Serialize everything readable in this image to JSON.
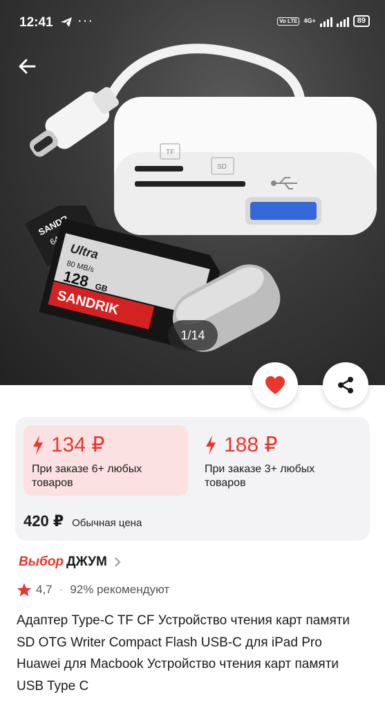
{
  "status_bar": {
    "time": "12:41",
    "more": "···",
    "volte": "Vo LTE",
    "network": "4G+",
    "battery": "89"
  },
  "gallery": {
    "counter": "1/14",
    "sd_card": {
      "brand": "SANDRIK",
      "line": "Ultra",
      "capacity": "128",
      "unit": "GB",
      "speed": "80 MB/s"
    },
    "micro_sd": {
      "brand": "SANDR",
      "capacity": "64 GB"
    },
    "reader_slots": [
      "TF",
      "SD"
    ]
  },
  "prices": {
    "tier1": {
      "price": "134 ₽",
      "note": "При заказе 6+ любых товаров"
    },
    "tier2": {
      "price": "188 ₽",
      "note": "При заказе 3+ любых товаров"
    },
    "regular": {
      "price": "420 ₽",
      "label": "Обычная цена"
    }
  },
  "brand": {
    "choice": "Выбор",
    "name": "ДЖУМ"
  },
  "rating": {
    "value": "4,7",
    "separator": "·",
    "recommend": "92% рекомендуют"
  },
  "product_title": "Адаптер Type-C TF CF Устройство чтения карт памяти SD OTG Writer Compact Flash USB-C для iPad Pro Huawei для Macbook Устройство чтения карт памяти USB Type C",
  "colors": {
    "accent": "#e8372c",
    "tier_highlight": "#fbe1e1",
    "card_bg": "#f3f3f5"
  }
}
